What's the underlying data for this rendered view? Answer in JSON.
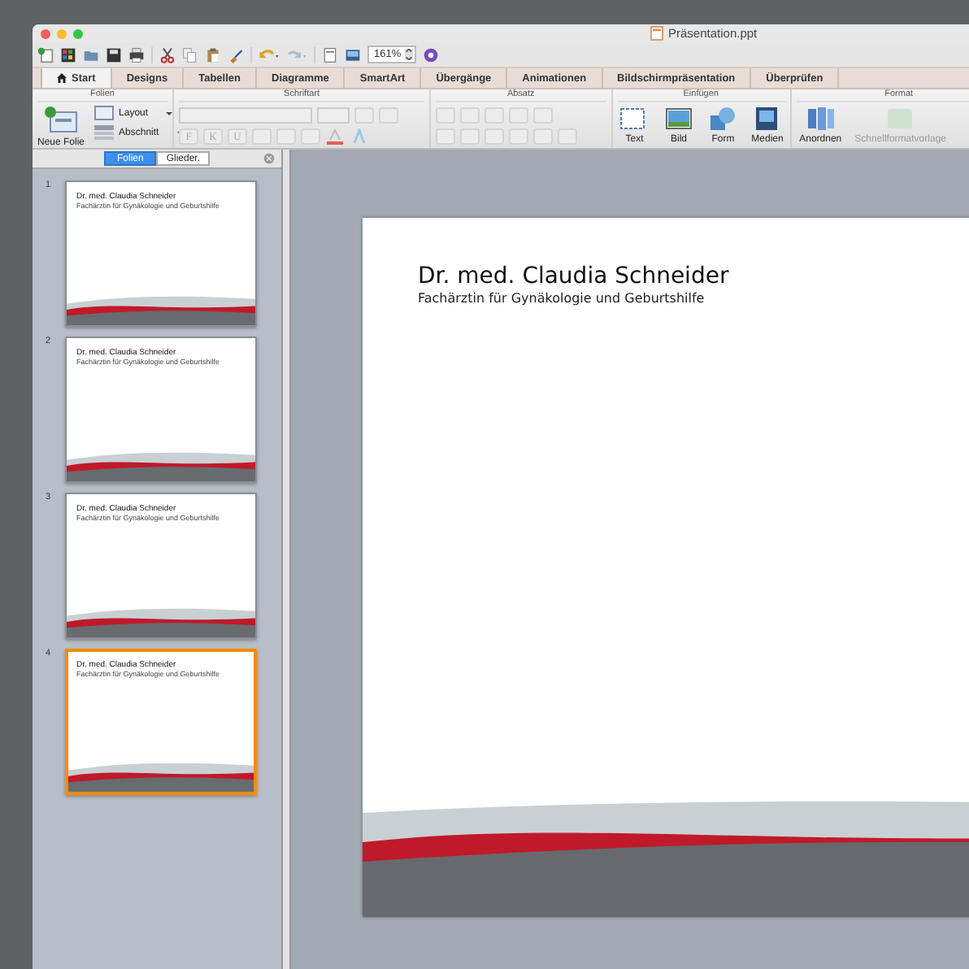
{
  "window": {
    "title": "Präsentation.ppt"
  },
  "toolbar": {
    "zoom": "161%"
  },
  "tabs": [
    {
      "label": "Start",
      "selected": true
    },
    {
      "label": "Designs",
      "selected": false
    },
    {
      "label": "Tabellen",
      "selected": false
    },
    {
      "label": "Diagramme",
      "selected": false
    },
    {
      "label": "SmartArt",
      "selected": false
    },
    {
      "label": "Übergänge",
      "selected": false
    },
    {
      "label": "Animationen",
      "selected": false
    },
    {
      "label": "Bildschirmpräsentation",
      "selected": false
    },
    {
      "label": "Überprüfen",
      "selected": false
    }
  ],
  "ribbon": {
    "slides_group": {
      "title": "Folien",
      "new_slide": "Neue Folie",
      "layout": "Layout",
      "section": "Abschnitt"
    },
    "font_group": {
      "title": "Schriftart",
      "buttons": [
        "F",
        "K",
        "U"
      ]
    },
    "paragraph_group": {
      "title": "Absatz"
    },
    "insert_group": {
      "title": "Einfügen",
      "buttons": [
        {
          "label": "Text",
          "kind": "text"
        },
        {
          "label": "Bild",
          "kind": "image"
        },
        {
          "label": "Form",
          "kind": "shape"
        },
        {
          "label": "Medien",
          "kind": "media"
        }
      ]
    },
    "format_group": {
      "title": "Format",
      "buttons": [
        {
          "label": "Anordnen",
          "disabled": false
        },
        {
          "label": "Schnellformatvorlage",
          "disabled": true
        }
      ]
    }
  },
  "pane_tabs": [
    {
      "label": "Folien",
      "selected": true
    },
    {
      "label": "Glieder.",
      "selected": false
    }
  ],
  "slides": [
    {
      "number": "1",
      "title": "Dr. med. Claudia Schneider",
      "subtitle": "Fachärztin für Gynäkologie und Geburtshilfe",
      "selected": false
    },
    {
      "number": "2",
      "title": "Dr. med. Claudia Schneider",
      "subtitle": "Fachärztin für Gynäkologie und Geburtshilfe",
      "selected": false
    },
    {
      "number": "3",
      "title": "Dr. med. Claudia Schneider",
      "subtitle": "Fachärztin für Gynäkologie und Geburtshilfe",
      "selected": false
    },
    {
      "number": "4",
      "title": "Dr. med. Claudia Schneider",
      "subtitle": "Fachärztin für Gynäkologie und Geburtshilfe",
      "selected": true
    }
  ],
  "current_slide": {
    "title": "Dr. med. Claudia Schneider",
    "subtitle": "Fachärztin für Gynäkologie und Geburtshilfe"
  }
}
